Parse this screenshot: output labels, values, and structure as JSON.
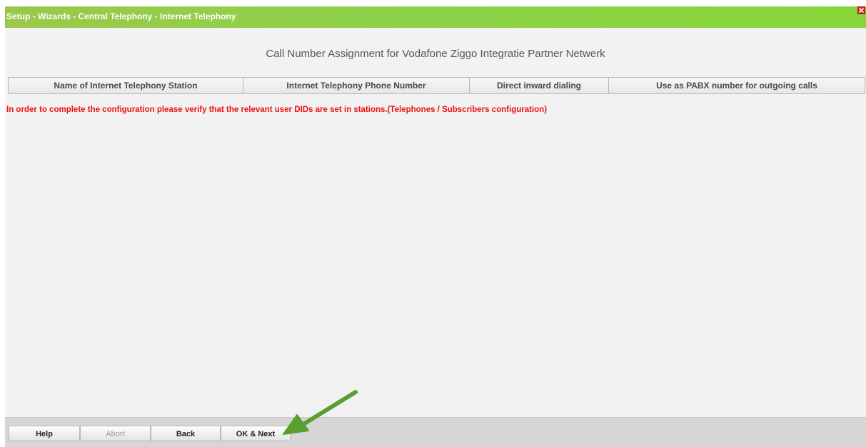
{
  "window": {
    "title": "Setup - Wizards - Central Telephony - Internet Telephony"
  },
  "page": {
    "heading": "Call Number Assignment for Vodafone Ziggo Integratie Partner Netwerk"
  },
  "table": {
    "columns": [
      "Name of Internet Telephony Station",
      "Internet Telephony Phone Number",
      "Direct inward dialing",
      "Use as PABX number for outgoing calls"
    ]
  },
  "notice": {
    "text": "In order to complete the configuration please verify that the relevant user DIDs are set in stations.(Telephones / Subscribers configuration)",
    "color": "#ee1111"
  },
  "footer": {
    "buttons": [
      {
        "label": "Help",
        "enabled": true
      },
      {
        "label": "Abort",
        "enabled": false
      },
      {
        "label": "Back",
        "enabled": true
      },
      {
        "label": "OK & Next",
        "enabled": true
      }
    ]
  },
  "annotation": {
    "icon": "green-arrow-pointer",
    "color": "#5a9e2f"
  },
  "colors": {
    "titlebar": "#8fd14a",
    "background": "#f2f2f2",
    "close": "#d8251e"
  }
}
